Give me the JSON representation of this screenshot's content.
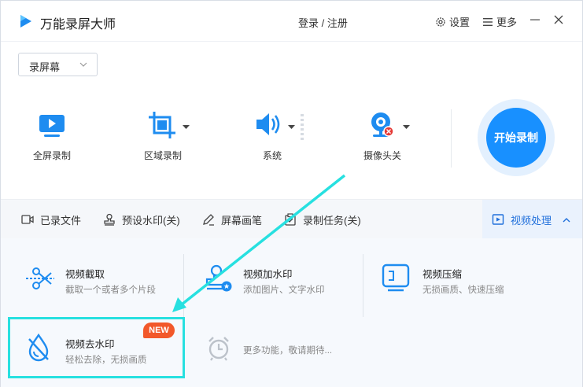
{
  "app": {
    "title": "万能录屏大师"
  },
  "titlebar": {
    "login": "登录 / 注册",
    "settings": "设置",
    "more": "更多"
  },
  "mode": {
    "selected": "录屏幕"
  },
  "tools": {
    "fullscreen": "全屏录制",
    "region": "区域录制",
    "audio": "系统",
    "camera": "摄像头关"
  },
  "record_button": "开始录制",
  "nav": {
    "items": [
      "已录文件",
      "预设水印(关)",
      "屏幕画笔",
      "录制任务(关)"
    ],
    "active": "视频处理"
  },
  "features": [
    {
      "title": "视频截取",
      "desc": "截取一个或者多个片段"
    },
    {
      "title": "视频加水印",
      "desc": "添加图片、文字水印"
    },
    {
      "title": "视频压缩",
      "desc": "无损画质、快速压缩"
    },
    {
      "title": "视频去水印",
      "desc": "轻松去除，无损画质",
      "badge": "NEW"
    },
    {
      "title": "",
      "desc": "更多功能，敬请期待..."
    }
  ],
  "colors": {
    "accent": "#1890ff",
    "highlight": "#27e0e0",
    "badge": "#f2582a"
  }
}
